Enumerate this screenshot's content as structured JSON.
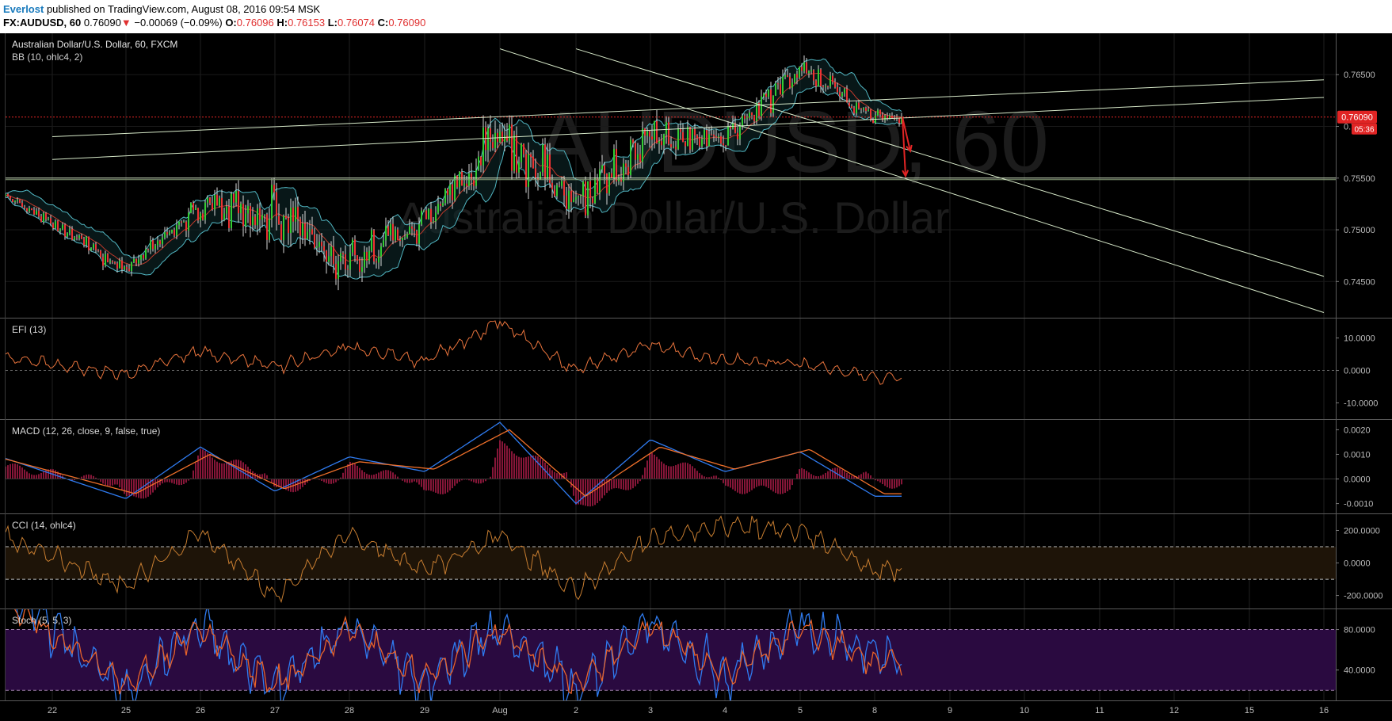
{
  "header": {
    "author": "Everlost",
    "published_text": "published on TradingView.com, August 08, 2016 09:54 MSK",
    "symbol": "FX:AUDUSD, 60",
    "last": "0.76090",
    "change_arrow": "▼",
    "change": "−0.00069 (−0.09%)",
    "o_label": "O:",
    "o_value": "0.76096",
    "h_label": "H:",
    "h_value": "0.76153",
    "l_label": "L:",
    "l_value": "0.76074",
    "c_label": "C:",
    "c_value": "0.76090"
  },
  "watermark": {
    "symbol": "AUDUSD, 60",
    "name": "Australian Dollar/U.S. Dollar"
  },
  "colors": {
    "up_candle": "#33cc33",
    "down_candle": "#ee3333",
    "bb_band": "#52b8c4",
    "bb_basis": "#c0392b",
    "trendline": "#d6e8c8",
    "efi_line": "#e8733c",
    "macd_line": "#2f7bf0",
    "signal_line": "#f0702a",
    "histogram": "#e0245e",
    "cci_line": "#c77d30",
    "cci_band": "#1e1408",
    "stoch_k": "#2f7bf0",
    "stoch_d": "#e8632a",
    "stoch_band": "#2a0a40",
    "price_label": "#e02424",
    "text": "#bbbbbb"
  },
  "x_axis": {
    "labels": [
      "22",
      "25",
      "26",
      "27",
      "28",
      "29",
      "Aug",
      "2",
      "3",
      "4",
      "5",
      "8",
      "9",
      "10",
      "11",
      "12",
      "15",
      "16"
    ]
  },
  "chart_data": [
    {
      "type": "candlestick",
      "title": "Australian Dollar/U.S. Dollar, 60, FXCM",
      "indicator": "BB (10, ohlc4, 2)",
      "ylim": [
        0.7415,
        0.769
      ],
      "y_ticks": [
        "0.76500",
        "0.76000",
        "0.75500",
        "0.75000",
        "0.74500"
      ],
      "last_price": "0.76090",
      "countdown": "05:36",
      "key_points": {
        "labels": [
          "22",
          "25",
          "26",
          "27",
          "28",
          "29",
          "Aug",
          "2",
          "3",
          "4",
          "5",
          "8"
        ],
        "close": [
          0.7505,
          0.7462,
          0.7525,
          0.751,
          0.7465,
          0.7508,
          0.759,
          0.7525,
          0.7585,
          0.759,
          0.7655,
          0.7609
        ],
        "high": [
          0.7515,
          0.748,
          0.7545,
          0.7565,
          0.7505,
          0.754,
          0.762,
          0.756,
          0.764,
          0.7625,
          0.7665,
          0.762
        ],
        "low": [
          0.749,
          0.7445,
          0.7495,
          0.746,
          0.7422,
          0.749,
          0.752,
          0.7482,
          0.7555,
          0.757,
          0.761,
          0.7595
        ]
      },
      "horizontal_levels": [
        0.7609,
        0.755
      ],
      "trendlines": [
        {
          "from": [
            "22",
            0.759
          ],
          "to": [
            "16",
            0.7645
          ]
        },
        {
          "from": [
            "22",
            0.7568
          ],
          "to": [
            "16",
            0.7628
          ]
        },
        {
          "from": [
            "Aug",
            0.7675
          ],
          "to": [
            "16",
            0.742
          ]
        },
        {
          "from": [
            "2",
            0.7675
          ],
          "to": [
            "16",
            0.7455
          ]
        }
      ],
      "projection_arrows": [
        {
          "from": [
            "8",
            0.7609
          ],
          "to": [
            "8",
            0.7576
          ]
        },
        {
          "from": [
            "8",
            0.7609
          ],
          "to": [
            "8",
            0.7552
          ]
        }
      ]
    },
    {
      "type": "line",
      "title": "EFI (13)",
      "ylim": [
        -15,
        16
      ],
      "y_ticks": [
        "10.0000",
        "0.0000",
        "-10.0000"
      ],
      "key_points": {
        "labels": [
          "22",
          "25",
          "26",
          "27",
          "28",
          "29",
          "Aug",
          "2",
          "3",
          "4",
          "5",
          "8"
        ],
        "values": [
          2,
          -1,
          6,
          1,
          7,
          3,
          15,
          0,
          8,
          3,
          2,
          -2
        ]
      }
    },
    {
      "type": "line",
      "title": "MACD (12, 26, close, 9, false, true)",
      "ylim": [
        -0.0014,
        0.0024
      ],
      "y_ticks": [
        "0.0020",
        "0.0010",
        "0.0000",
        "-0.0010"
      ],
      "series": [
        {
          "key": "macd",
          "values": [
            0.0002,
            -0.0008,
            0.0013,
            -0.0005,
            0.0009,
            0.0003,
            0.0023,
            -0.001,
            0.0016,
            0.0003,
            0.0011,
            -0.0007
          ]
        },
        {
          "key": "signal",
          "values": [
            0.0002,
            -0.0006,
            0.001,
            -0.0004,
            0.0007,
            0.0004,
            0.002,
            -0.0007,
            0.0013,
            0.0004,
            0.0012,
            -0.0006
          ]
        }
      ],
      "key_points": {
        "labels": [
          "22",
          "25",
          "26",
          "27",
          "28",
          "29",
          "Aug",
          "2",
          "3",
          "4",
          "5",
          "8"
        ]
      }
    },
    {
      "type": "line",
      "title": "CCI (14, ohlc4)",
      "ylim": [
        -280,
        300
      ],
      "y_ticks": [
        "200.0000",
        "0.0000",
        "-200.0000"
      ],
      "bands": [
        100,
        -100
      ],
      "key_points": {
        "labels": [
          "22",
          "25",
          "26",
          "27",
          "28",
          "29",
          "Aug",
          "2",
          "3",
          "4",
          "5",
          "8"
        ],
        "values": [
          50,
          -150,
          200,
          -200,
          180,
          -50,
          180,
          -180,
          150,
          220,
          200,
          -50
        ]
      }
    },
    {
      "type": "line",
      "title": "Stoch (5, 5, 3)",
      "ylim": [
        10,
        100
      ],
      "y_ticks": [
        "80.0000",
        "40.0000"
      ],
      "bands": [
        80,
        20
      ],
      "series": [
        {
          "key": "k",
          "values": [
            80,
            20,
            85,
            20,
            85,
            25,
            85,
            20,
            90,
            30,
            85,
            55
          ]
        },
        {
          "key": "d",
          "values": [
            75,
            25,
            80,
            25,
            80,
            30,
            80,
            25,
            85,
            35,
            80,
            50
          ]
        }
      ],
      "key_points": {
        "labels": [
          "22",
          "25",
          "26",
          "27",
          "28",
          "29",
          "Aug",
          "2",
          "3",
          "4",
          "5",
          "8"
        ]
      }
    }
  ]
}
